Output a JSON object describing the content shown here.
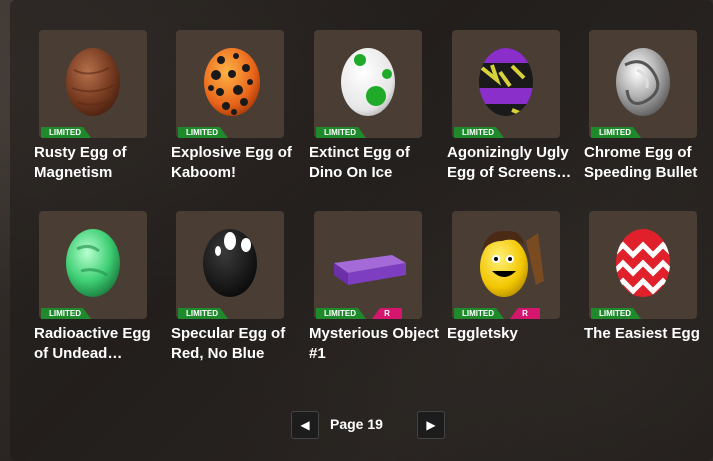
{
  "items": [
    {
      "name": "Rusty Egg of Magnetism",
      "tag": "LIMITED",
      "rtag": "",
      "icon": "rusty-egg"
    },
    {
      "name": "Explosive Egg of Kaboom!",
      "tag": "LIMITED",
      "rtag": "",
      "icon": "explosive-egg"
    },
    {
      "name": "Extinct Egg of Dino On Ice",
      "tag": "LIMITED",
      "rtag": "",
      "icon": "dino-egg"
    },
    {
      "name": "Agonizingly Ugly Egg of Screens…",
      "tag": "LIMITED",
      "rtag": "",
      "icon": "ugly-egg"
    },
    {
      "name": "Chrome Egg of Speeding Bullet",
      "tag": "LIMITED",
      "rtag": "",
      "icon": "chrome-egg"
    },
    {
      "name": "Radioactive Egg of Undead…",
      "tag": "LIMITED",
      "rtag": "",
      "icon": "radioactive-egg"
    },
    {
      "name": "Specular Egg of Red, No Blue",
      "tag": "LIMITED",
      "rtag": "",
      "icon": "specular-egg"
    },
    {
      "name": "Mysterious Object #1",
      "tag": "LIMITED",
      "rtag": "R",
      "icon": "purple-block"
    },
    {
      "name": "Eggletsky",
      "tag": "LIMITED",
      "rtag": "R",
      "icon": "eggletsky-egg"
    },
    {
      "name": "The Easiest Egg",
      "tag": "LIMITED",
      "rtag": "",
      "icon": "zigzag-egg"
    }
  ],
  "pager": {
    "prev": "◀",
    "label": "Page 19",
    "next": "▶"
  },
  "colors": {
    "limited": "#1f8a2b",
    "r_badge": "#d4166f",
    "thumb_bg": "#4a3d34"
  }
}
